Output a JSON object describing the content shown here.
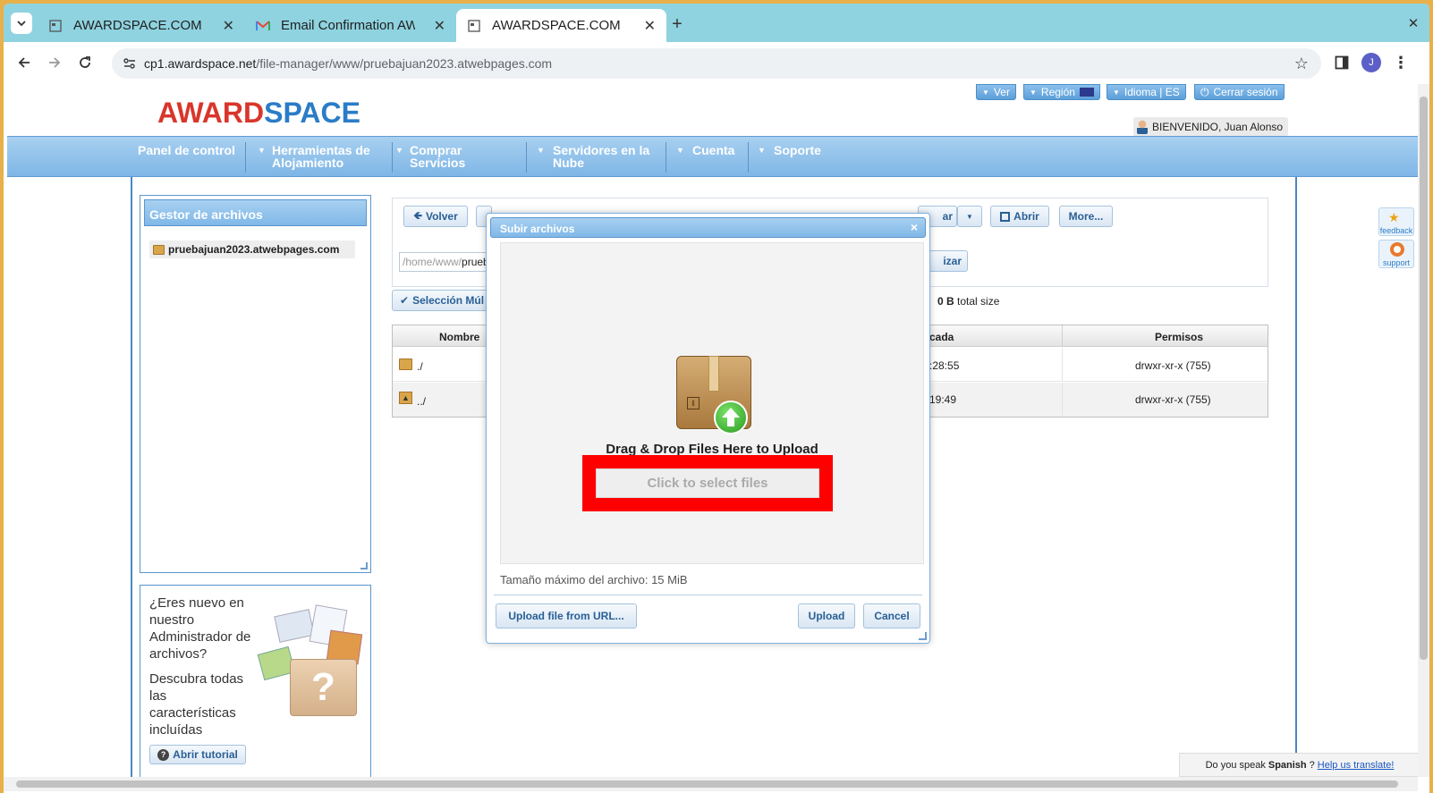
{
  "browser": {
    "tabs": [
      {
        "title": "AWARDSPACE.COM",
        "active": false
      },
      {
        "title": "Email Confirmation AWA",
        "active": false
      },
      {
        "title": "AWARDSPACE.COM",
        "active": true
      }
    ],
    "new_tab": "+",
    "close_window": "✕",
    "url_host": "cp1.awardspace.net",
    "url_path": "/file-manager/www/pruebajuan2023.atwebpages.com",
    "profile_initial": "J"
  },
  "site": {
    "logo_part1": "AWARD",
    "logo_part2": "SPACE",
    "top_buttons": {
      "ver": "Ver",
      "region": "Región",
      "idioma": "Idioma | ES",
      "logout": "Cerrar sesión"
    },
    "welcome": "BIENVENIDO, Juan Alonso",
    "nav": [
      {
        "label": "Panel de control"
      },
      {
        "label": "Herramientas de Alojamiento"
      },
      {
        "label": "Comprar Servicios"
      },
      {
        "label": "Servidores en la Nube"
      },
      {
        "label": "Cuenta"
      },
      {
        "label": "Soporte"
      }
    ]
  },
  "sidebar": {
    "title": "Gestor de archivos",
    "tree_item": "pruebajuan2023.atwebpages.com",
    "promo": {
      "q1": "¿Eres nuevo en nuestro Administrador de archivos?",
      "q2": "Descubra todas las características incluídas",
      "tutorial": "Abrir tutorial"
    }
  },
  "file_manager": {
    "volver": "Volver",
    "hidden_button": "ar",
    "abrir": "Abrir",
    "more": "More...",
    "path_prefix": "/home/www/",
    "path_value": "prueb",
    "actualizar": "izar",
    "seleccion": "Selección Múl",
    "total_size_value": "0 B",
    "total_size_label": "total size",
    "columns": {
      "nombre": "Nombre",
      "modificada": "cada",
      "permisos": "Permisos"
    },
    "rows": [
      {
        "name": "./",
        "time": ":28:55",
        "perms": "drwxr-xr-x (755)"
      },
      {
        "name": "../",
        "time": "19:49",
        "perms": "drwxr-xr-x (755)"
      }
    ]
  },
  "upload_dialog": {
    "title": "Subir archivos",
    "close": "×",
    "drop_text": "Drag & Drop Files Here to Upload",
    "select_button": "Click to select files",
    "max_size": "Tamaño máximo del archivo: 15 MiB",
    "from_url": "Upload file from URL...",
    "upload": "Upload",
    "cancel": "Cancel"
  },
  "side_widgets": {
    "feedback": "feedback",
    "support": "support"
  },
  "translate_bar": {
    "question_a": "Do you speak ",
    "language": "Spanish",
    "question_b": "?",
    "link": "Help us translate!"
  },
  "colors": {
    "accent": "#7fb6e6",
    "highlight": "#ff0000",
    "logo_red": "#d9362b",
    "logo_blue": "#2a7cc7"
  }
}
